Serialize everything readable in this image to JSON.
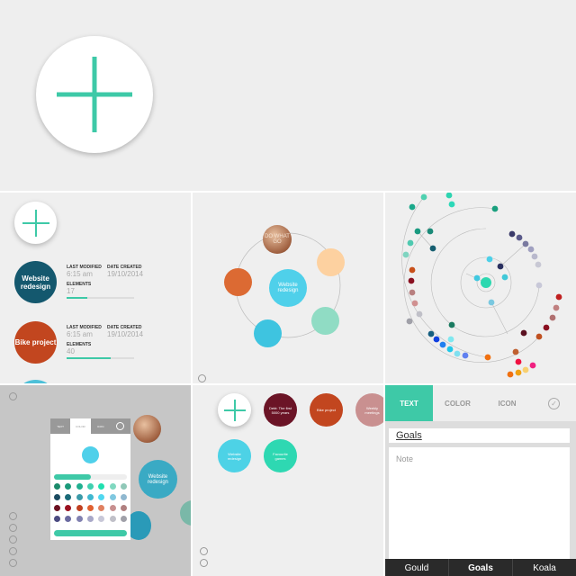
{
  "colors": {
    "accent": "#3ec9a7",
    "website": "#14586e",
    "bike": "#c2461f"
  },
  "projects_list": {
    "items": [
      {
        "title": "Website redesign",
        "last_modified_label": "LAST MODIFIED",
        "last_modified": "6:15 am",
        "date_created_label": "DATE CREATED",
        "date_created": "19/10/2014",
        "elements_label": "ELEMENTS",
        "elements": "17",
        "progress": 0.3,
        "color": "#14586e"
      },
      {
        "title": "Bike project",
        "last_modified_label": "LAST MODIFIED",
        "last_modified": "6:15 am",
        "date_created_label": "DATE CREATED",
        "date_created": "19/10/2014",
        "elements_label": "ELEMENTS",
        "elements": "40",
        "progress": 0.65,
        "color": "#c2461f"
      }
    ]
  },
  "mindmap": {
    "center": "Website redesign",
    "photo_text": "DO WHAT GO"
  },
  "radial": {
    "dot_colors": [
      "#4fd1b0",
      "#2dd4b0",
      "#1aa88a",
      "#2dd8b8",
      "#1aa07e",
      "#1a9a80",
      "#1a8a78",
      "#4fc9b0",
      "#155e70",
      "#7fd4c0",
      "#3a3a6a",
      "#5a5a8a",
      "#7a7aa0",
      "#a0a0c0",
      "#b8b8cc",
      "#c8c8d4",
      "#4dd0e8",
      "#2a3060",
      "#40c8d8",
      "#40c8e0",
      "#c8c8d8",
      "#7ac8e0",
      "#c8501a",
      "#8a1020",
      "#b88080",
      "#d09090",
      "#c0c0c8",
      "#a0a0a8",
      "#1a7a60",
      "#155e80",
      "#1040e0",
      "#2080f0",
      "#80e8f0",
      "#20c8e8",
      "#80e0f0",
      "#6080f0",
      "#c02020",
      "#c08080",
      "#b07070",
      "#8a1020",
      "#5a1020",
      "#c05020",
      "#c06030",
      "#f07010",
      "#f01040",
      "#f02080",
      "#f8d070",
      "#f0a010",
      "#f07010"
    ],
    "center_color": "#2dd8b0"
  },
  "color_picker": {
    "tabs": [
      "TEXT",
      "COLOR",
      "ICON"
    ],
    "background_node": "Website redesign",
    "swatches": [
      [
        "#1a8a6a",
        "#1a9a7a",
        "#20b090",
        "#40d0b0",
        "#20e0b0",
        "#80d8c0",
        "#90c8b8"
      ],
      [
        "#1a4a60",
        "#1a6a78",
        "#3a9aa8",
        "#40b8d0",
        "#50d8f0",
        "#80c8e0",
        "#90b8d0"
      ],
      [
        "#6a1020",
        "#9a1020",
        "#c04020",
        "#e06030",
        "#e08060",
        "#c89090",
        "#b08080"
      ],
      [
        "#4a4a80",
        "#6a6aa0",
        "#8080b0",
        "#a8a8c8",
        "#c8c8d8",
        "#c0c0c8",
        "#a0a0a8"
      ]
    ]
  },
  "grid": {
    "items": [
      {
        "title": "Debt: The first 5000 years",
        "color": "#6b1426"
      },
      {
        "title": "Bike project",
        "color": "#c2461f"
      },
      {
        "title": "Weekly meetings",
        "color": "#c99090"
      },
      {
        "title": "Website redesign",
        "color": "#4dd2e6"
      },
      {
        "title": "Favourite games",
        "color": "#2ed8b2"
      }
    ]
  },
  "editor": {
    "tabs": [
      "TEXT",
      "COLOR",
      "ICON"
    ],
    "active_tab": "TEXT",
    "title_value": "Goals",
    "note_placeholder": "Note",
    "suggestions": [
      "Gould",
      "Goals",
      "Koala"
    ]
  }
}
